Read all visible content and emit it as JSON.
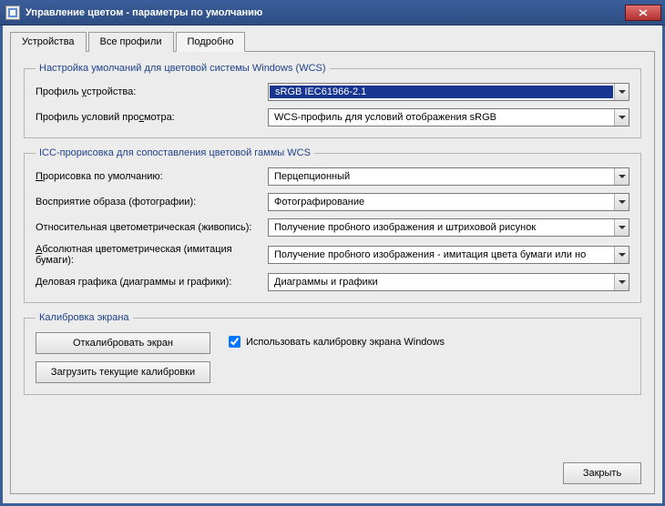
{
  "titlebar": {
    "title": "Управление цветом - параметры по умолчанию"
  },
  "tabs": {
    "devices": "Устройства",
    "allProfiles": "Все профили",
    "advanced": "Подробно"
  },
  "wcsDefaults": {
    "legend": "Настройка умолчаний для цветовой системы Windows (WCS)",
    "deviceProfileLabelPrefix": "Профиль ",
    "deviceProfileLabelU": "у",
    "deviceProfileLabelSuffix": "стройства:",
    "deviceProfileValue": "sRGB IEC61966-2.1",
    "viewingProfileLabelPrefix": "Профиль условий про",
    "viewingProfileLabelU": "с",
    "viewingProfileLabelSuffix": "мотра:",
    "viewingProfileValue": "WCS-профиль для условий отображения sRGB"
  },
  "iccRendering": {
    "legend": "ICC-прорисовка для сопоставления цветовой гаммы WCS",
    "defaultRendLabelU": "П",
    "defaultRendLabelSuffix": "рорисовка по умолчанию:",
    "defaultRendValue": "Перцепционный",
    "perceptualLabel": "Восприятие образа (фотографии):",
    "perceptualValue": "Фотографирование",
    "relativeLabel": "Относительная цветометрическая (живопись):",
    "relativeValue": "Получение пробного изображения и штриховой рисунок",
    "absoluteLabelU": "А",
    "absoluteLabelSuffix": "бсолютная цветометрическая (имитация бумаги):",
    "absoluteValue": "Получение пробного изображения - имитация цвета бумаги или но",
    "businessLabelU": "Д",
    "businessLabelSuffix": "еловая графика (диаграммы и графики):",
    "businessValue": "Диаграммы и графики"
  },
  "calibration": {
    "legend": "Калибровка экрана",
    "calibrateBtnPrefix": "О",
    "calibrateBtnU": "т",
    "calibrateBtnSuffix": "калибровать экран",
    "loadBtnPrefix": "",
    "loadBtnU": "З",
    "loadBtnSuffix": "агрузить текущие калибровки",
    "useCheckboxLabel": "Использовать калибровку экрана Windows"
  },
  "footer": {
    "close": "Закрыть"
  }
}
